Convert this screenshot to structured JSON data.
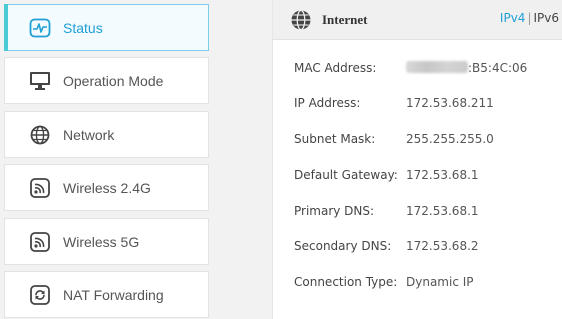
{
  "sidebar": {
    "items": [
      {
        "label": "Status",
        "icon": "status-icon",
        "active": true
      },
      {
        "label": "Operation Mode",
        "icon": "monitor-icon",
        "active": false
      },
      {
        "label": "Network",
        "icon": "globe-icon",
        "active": false
      },
      {
        "label": "Wireless 2.4G",
        "icon": "wireless-icon",
        "active": false
      },
      {
        "label": "Wireless 5G",
        "icon": "wireless-icon",
        "active": false
      },
      {
        "label": "NAT Forwarding",
        "icon": "refresh-icon",
        "active": false
      }
    ]
  },
  "internet": {
    "title": "Internet",
    "ipv4": "IPv4",
    "separator": "|",
    "ipv6": "IPv6",
    "rows": [
      {
        "label": "MAC Address:",
        "value": ":B5:4C:06",
        "redacted_prefix": true
      },
      {
        "label": "IP Address:",
        "value": "172.53.68.211"
      },
      {
        "label": "Subnet Mask:",
        "value": "255.255.255.0"
      },
      {
        "label": "Default Gateway:",
        "value": "172.53.68.1"
      },
      {
        "label": "Primary DNS:",
        "value": "172.53.68.1"
      },
      {
        "label": "Secondary DNS:",
        "value": "172.53.68.2"
      },
      {
        "label": "Connection Type:",
        "value": "Dynamic IP"
      }
    ]
  },
  "colors": {
    "accent": "#1e9fd6",
    "active_bar": "#4acbd6",
    "background": "#f2f2f2"
  }
}
